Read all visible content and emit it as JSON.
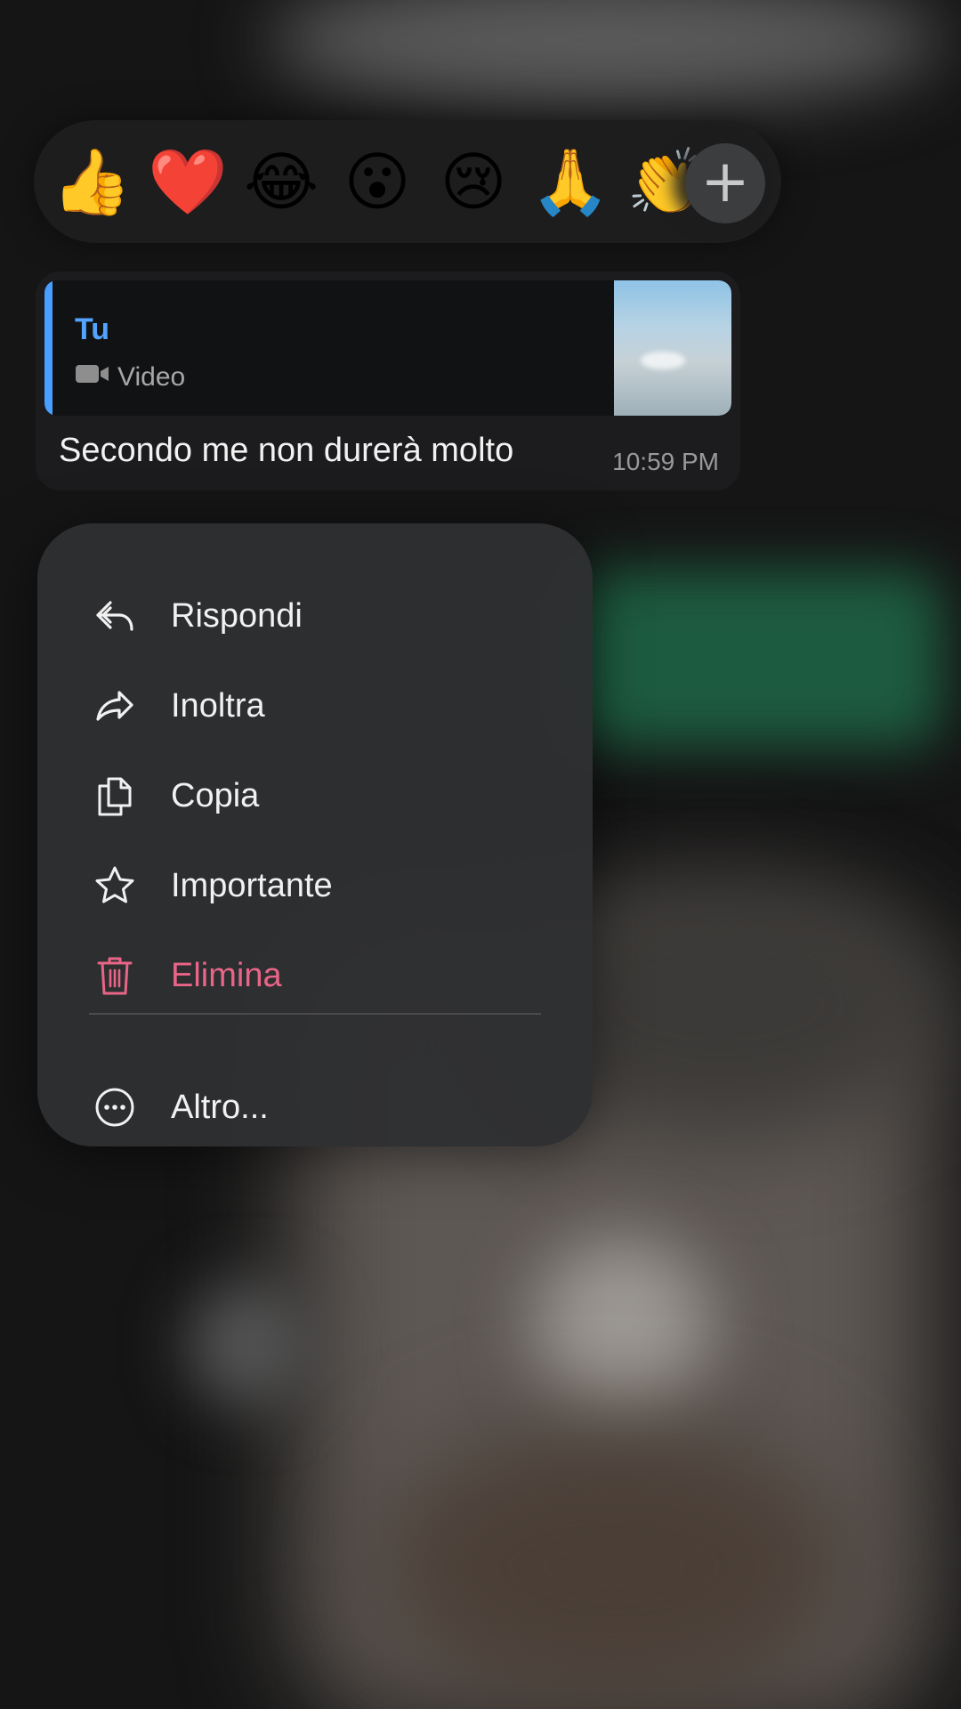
{
  "reactions": {
    "emojis": [
      "👍",
      "❤️",
      "😂",
      "😮",
      "😢",
      "🙏",
      "👏"
    ],
    "more_label": "+"
  },
  "message": {
    "quote": {
      "author": "Tu",
      "media_type": "Video",
      "icon": "video-camera-icon"
    },
    "text": "Secondo me non durerà molto",
    "time": "10:59 PM"
  },
  "menu": {
    "items": [
      {
        "label": "Rispondi",
        "icon": "reply-icon"
      },
      {
        "label": "Inoltra",
        "icon": "forward-icon"
      },
      {
        "label": "Copia",
        "icon": "copy-icon"
      },
      {
        "label": "Importante",
        "icon": "star-icon"
      },
      {
        "label": "Elimina",
        "icon": "trash-icon",
        "color": "#e86588"
      },
      {
        "label": "Altro...",
        "icon": "more-icon"
      }
    ]
  },
  "colors": {
    "accent": "#4a9eff",
    "danger": "#e86588",
    "menu_background": "#2e2f32"
  }
}
